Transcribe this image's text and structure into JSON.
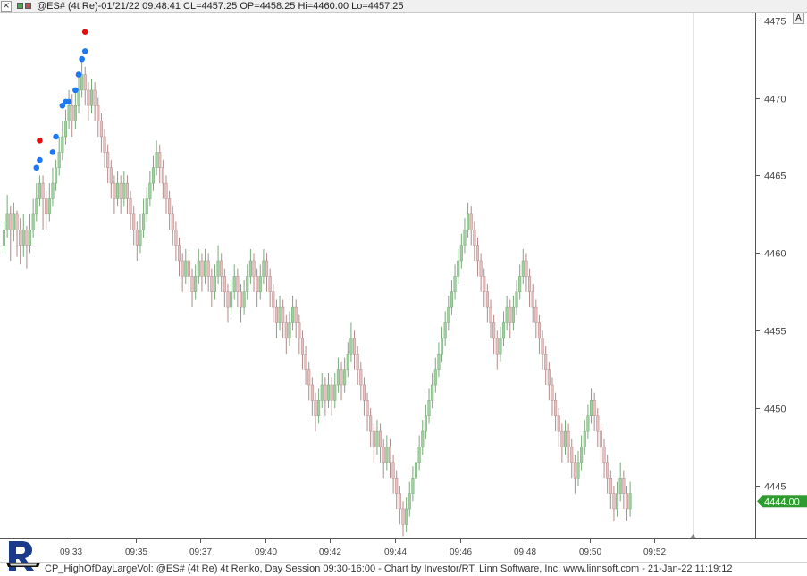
{
  "window": {
    "close_glyph": "×",
    "legend": "@ES# (4t Re)-01/21/22 09:48:41 CL=4457.25 OP=4458.25 Hi=4460.00 Lo=4457.25",
    "autoscale_label": "A"
  },
  "footer": {
    "caption": "CP_HighOfDayLargeVol: @ES# (4t Re) 4t Renko, Day Session 09:30-16:00 - Chart by Investor/RT, Linn Software, Inc. www.linnsoft.com - 21-Jan-22 11:19:12"
  },
  "colors": {
    "up_bar": "#9fd19f",
    "up_bar_edge": "#7aa97a",
    "down_bar": "#e8c0c0",
    "down_bar_edge": "#b08a8a",
    "blue_marker": "#1e78f0",
    "red_marker": "#e01010",
    "last_price_bg": "#2f9a2f"
  },
  "chart_data": {
    "type": "renko",
    "instrument": "@ES#",
    "brick_size_ticks": 4,
    "brick_size_points": 1.0,
    "y_ticks": [
      4445,
      4450,
      4455,
      4460,
      4465,
      4470,
      4475
    ],
    "ylim": [
      4441.6,
      4475.5
    ],
    "x_ticks": [
      "09:33",
      "09:35",
      "09:37",
      "09:40",
      "09:42",
      "09:44",
      "09:46",
      "09:48",
      "09:50",
      "09:52"
    ],
    "x_tick_bar_index": [
      20.5,
      40.5,
      60.5,
      80.5,
      100.5,
      120.5,
      140.5,
      160.5,
      180.5,
      200.5
    ],
    "last_price": "4444.00",
    "bars": [
      [
        4460.5,
        4461.5,
        4460.0,
        4462.0
      ],
      [
        4461.5,
        4462.5,
        4461.0,
        4463.75
      ],
      [
        4462.5,
        4461.5,
        4459.5,
        4463.0
      ],
      [
        4461.5,
        4462.5,
        4460.75,
        4463.25
      ],
      [
        4462.5,
        4461.5,
        4459.75,
        4462.75
      ],
      [
        4461.5,
        4460.5,
        4459.25,
        4462.25
      ],
      [
        4460.5,
        4461.5,
        4459.75,
        4462.5
      ],
      [
        4461.5,
        4460.5,
        4459.0,
        4461.75
      ],
      [
        4460.5,
        4461.5,
        4460.0,
        4462.5
      ],
      [
        4461.5,
        4462.5,
        4461.0,
        4463.5
      ],
      [
        4462.5,
        4463.5,
        4462.0,
        4464.5
      ],
      [
        4463.5,
        4464.5,
        4463.0,
        4465.0
      ],
      [
        4464.5,
        4463.5,
        4461.5,
        4465.0
      ],
      [
        4463.5,
        4462.5,
        4461.5,
        4464.0
      ],
      [
        4462.5,
        4463.5,
        4462.0,
        4464.5
      ],
      [
        4463.5,
        4464.5,
        4463.0,
        4465.5
      ],
      [
        4464.5,
        4465.5,
        4464.0,
        4466.0
      ],
      [
        4465.5,
        4466.5,
        4465.0,
        4467.5
      ],
      [
        4466.5,
        4467.5,
        4466.0,
        4468.5
      ],
      [
        4467.5,
        4468.5,
        4467.0,
        4469.25
      ],
      [
        4468.5,
        4469.5,
        4468.0,
        4470.5
      ],
      [
        4469.5,
        4468.5,
        4467.5,
        4470.25
      ],
      [
        4468.5,
        4469.5,
        4468.0,
        4470.5
      ],
      [
        4469.5,
        4470.5,
        4469.0,
        4471.5
      ],
      [
        4470.5,
        4471.5,
        4470.0,
        4472.5
      ],
      [
        4471.5,
        4470.5,
        4469.5,
        4472.0
      ],
      [
        4470.5,
        4469.5,
        4468.5,
        4471.0
      ],
      [
        4469.5,
        4470.5,
        4469.0,
        4471.25
      ],
      [
        4470.5,
        4469.5,
        4468.5,
        4471.0
      ],
      [
        4469.5,
        4468.5,
        4467.5,
        4470.0
      ],
      [
        4468.5,
        4467.5,
        4466.5,
        4469.0
      ],
      [
        4467.5,
        4466.5,
        4465.5,
        4468.0
      ],
      [
        4466.5,
        4465.5,
        4464.5,
        4467.0
      ],
      [
        4465.5,
        4464.5,
        4463.5,
        4466.0
      ],
      [
        4464.5,
        4463.5,
        4462.5,
        4465.0
      ],
      [
        4463.5,
        4464.5,
        4463.0,
        4465.25
      ],
      [
        4464.5,
        4463.5,
        4462.5,
        4465.0
      ],
      [
        4463.5,
        4464.5,
        4463.0,
        4465.25
      ],
      [
        4464.5,
        4463.5,
        4462.5,
        4465.0
      ],
      [
        4463.5,
        4462.5,
        4461.5,
        4464.0
      ],
      [
        4462.5,
        4461.5,
        4460.5,
        4463.0
      ],
      [
        4461.5,
        4460.5,
        4459.5,
        4462.0
      ],
      [
        4460.5,
        4461.5,
        4460.0,
        4462.5
      ],
      [
        4461.5,
        4462.5,
        4461.0,
        4463.5
      ],
      [
        4462.5,
        4463.5,
        4462.0,
        4464.25
      ],
      [
        4463.5,
        4464.5,
        4463.0,
        4465.25
      ],
      [
        4464.5,
        4465.5,
        4464.0,
        4466.25
      ],
      [
        4465.5,
        4466.5,
        4465.0,
        4467.25
      ],
      [
        4466.5,
        4465.5,
        4464.5,
        4467.0
      ],
      [
        4465.5,
        4464.5,
        4463.5,
        4466.0
      ],
      [
        4464.5,
        4463.5,
        4462.5,
        4465.0
      ],
      [
        4463.5,
        4462.5,
        4461.5,
        4464.0
      ],
      [
        4462.5,
        4461.5,
        4460.5,
        4463.0
      ],
      [
        4461.5,
        4460.5,
        4459.5,
        4462.0
      ],
      [
        4460.5,
        4459.5,
        4458.5,
        4461.0
      ],
      [
        4459.5,
        4458.5,
        4457.5,
        4460.0
      ],
      [
        4458.5,
        4459.5,
        4458.0,
        4460.25
      ],
      [
        4459.5,
        4458.5,
        4457.5,
        4460.0
      ],
      [
        4458.5,
        4457.5,
        4456.5,
        4459.0
      ],
      [
        4457.5,
        4458.5,
        4457.0,
        4459.25
      ],
      [
        4458.5,
        4459.5,
        4458.0,
        4460.25
      ],
      [
        4459.5,
        4458.5,
        4457.5,
        4460.0
      ],
      [
        4458.5,
        4459.5,
        4458.0,
        4460.25
      ],
      [
        4459.5,
        4458.5,
        4457.5,
        4460.0
      ],
      [
        4458.5,
        4457.5,
        4456.5,
        4459.0
      ],
      [
        4457.5,
        4458.5,
        4457.0,
        4459.25
      ],
      [
        4458.5,
        4459.5,
        4458.0,
        4460.5
      ],
      [
        4459.5,
        4458.5,
        4457.5,
        4460.0
      ],
      [
        4458.5,
        4457.5,
        4456.5,
        4459.0
      ],
      [
        4457.5,
        4456.5,
        4455.5,
        4458.0
      ],
      [
        4456.5,
        4457.5,
        4456.0,
        4458.25
      ],
      [
        4457.5,
        4458.5,
        4457.0,
        4459.25
      ],
      [
        4458.5,
        4457.5,
        4456.5,
        4459.0
      ],
      [
        4457.5,
        4456.5,
        4455.5,
        4458.0
      ],
      [
        4456.5,
        4457.5,
        4456.0,
        4458.25
      ],
      [
        4457.5,
        4458.5,
        4457.0,
        4459.25
      ],
      [
        4458.5,
        4459.5,
        4458.0,
        4460.25
      ],
      [
        4459.5,
        4458.5,
        4457.5,
        4460.0
      ],
      [
        4458.5,
        4457.5,
        4456.5,
        4459.0
      ],
      [
        4457.5,
        4458.5,
        4457.0,
        4459.25
      ],
      [
        4458.5,
        4459.5,
        4458.0,
        4460.25
      ],
      [
        4459.5,
        4458.5,
        4457.5,
        4460.0
      ],
      [
        4458.5,
        4457.5,
        4456.5,
        4459.0
      ],
      [
        4457.5,
        4456.5,
        4455.5,
        4458.0
      ],
      [
        4456.5,
        4455.5,
        4454.5,
        4457.0
      ],
      [
        4455.5,
        4456.5,
        4455.0,
        4457.25
      ],
      [
        4456.5,
        4455.5,
        4454.5,
        4457.0
      ],
      [
        4455.5,
        4454.5,
        4453.5,
        4456.0
      ],
      [
        4454.5,
        4455.5,
        4454.0,
        4456.25
      ],
      [
        4455.5,
        4456.5,
        4455.0,
        4457.25
      ],
      [
        4456.5,
        4455.5,
        4454.5,
        4457.0
      ],
      [
        4455.5,
        4454.5,
        4453.5,
        4456.0
      ],
      [
        4454.5,
        4453.5,
        4452.5,
        4455.0
      ],
      [
        4453.5,
        4452.5,
        4451.5,
        4454.0
      ],
      [
        4452.5,
        4451.5,
        4450.5,
        4453.0
      ],
      [
        4451.5,
        4450.5,
        4449.5,
        4452.0
      ],
      [
        4450.5,
        4449.5,
        4448.5,
        4451.0
      ],
      [
        4449.5,
        4450.5,
        4449.0,
        4451.25
      ],
      [
        4450.5,
        4451.5,
        4450.0,
        4452.25
      ],
      [
        4451.5,
        4450.5,
        4449.5,
        4452.0
      ],
      [
        4450.5,
        4451.5,
        4450.0,
        4452.25
      ],
      [
        4451.5,
        4450.5,
        4449.5,
        4452.0
      ],
      [
        4450.5,
        4451.5,
        4450.0,
        4452.25
      ],
      [
        4451.5,
        4452.5,
        4451.0,
        4453.25
      ],
      [
        4452.5,
        4451.5,
        4450.5,
        4453.0
      ],
      [
        4451.5,
        4452.5,
        4451.0,
        4453.25
      ],
      [
        4452.5,
        4453.5,
        4452.0,
        4454.25
      ],
      [
        4453.5,
        4454.5,
        4453.0,
        4455.5
      ],
      [
        4454.5,
        4453.5,
        4452.5,
        4455.0
      ],
      [
        4453.5,
        4452.5,
        4451.5,
        4454.0
      ],
      [
        4452.5,
        4451.5,
        4450.5,
        4453.0
      ],
      [
        4451.5,
        4450.5,
        4449.5,
        4452.0
      ],
      [
        4450.5,
        4449.5,
        4448.5,
        4451.0
      ],
      [
        4449.5,
        4448.5,
        4447.5,
        4450.0
      ],
      [
        4448.5,
        4447.5,
        4446.5,
        4449.0
      ],
      [
        4447.5,
        4448.5,
        4447.0,
        4449.25
      ],
      [
        4448.5,
        4447.5,
        4446.5,
        4449.0
      ],
      [
        4447.5,
        4446.5,
        4445.5,
        4448.0
      ],
      [
        4446.5,
        4447.5,
        4446.0,
        4448.25
      ],
      [
        4447.5,
        4446.5,
        4445.5,
        4448.0
      ],
      [
        4446.5,
        4445.5,
        4444.5,
        4447.0
      ],
      [
        4445.5,
        4444.5,
        4443.5,
        4446.0
      ],
      [
        4444.5,
        4443.5,
        4442.5,
        4445.0
      ],
      [
        4443.5,
        4442.5,
        4441.75,
        4444.0
      ],
      [
        4442.5,
        4443.5,
        4442.0,
        4444.25
      ],
      [
        4443.5,
        4444.5,
        4443.0,
        4445.25
      ],
      [
        4444.5,
        4445.5,
        4444.0,
        4446.25
      ],
      [
        4445.5,
        4446.5,
        4445.0,
        4447.25
      ],
      [
        4446.5,
        4447.5,
        4446.0,
        4448.25
      ],
      [
        4447.5,
        4448.5,
        4447.0,
        4449.25
      ],
      [
        4448.5,
        4449.5,
        4448.0,
        4450.25
      ],
      [
        4449.5,
        4450.5,
        4449.0,
        4451.25
      ],
      [
        4450.5,
        4451.5,
        4450.0,
        4452.25
      ],
      [
        4451.5,
        4452.5,
        4451.0,
        4453.25
      ],
      [
        4452.5,
        4453.5,
        4452.0,
        4454.25
      ],
      [
        4453.5,
        4454.5,
        4453.0,
        4455.25
      ],
      [
        4454.5,
        4455.5,
        4454.0,
        4456.25
      ],
      [
        4455.5,
        4456.5,
        4455.0,
        4457.25
      ],
      [
        4456.5,
        4457.5,
        4456.0,
        4458.25
      ],
      [
        4457.5,
        4458.5,
        4457.0,
        4459.25
      ],
      [
        4458.5,
        4459.5,
        4458.0,
        4460.25
      ],
      [
        4459.5,
        4460.5,
        4459.0,
        4461.25
      ],
      [
        4460.5,
        4461.5,
        4460.0,
        4462.25
      ],
      [
        4461.5,
        4462.5,
        4461.0,
        4463.25
      ],
      [
        4462.5,
        4461.5,
        4460.5,
        4463.0
      ],
      [
        4461.5,
        4460.5,
        4459.5,
        4462.0
      ],
      [
        4460.5,
        4459.5,
        4458.5,
        4461.0
      ],
      [
        4459.5,
        4458.5,
        4457.5,
        4460.0
      ],
      [
        4458.5,
        4457.5,
        4456.5,
        4459.0
      ],
      [
        4457.5,
        4456.5,
        4455.5,
        4458.0
      ],
      [
        4456.5,
        4455.5,
        4454.5,
        4457.0
      ],
      [
        4455.5,
        4454.5,
        4453.5,
        4456.0
      ],
      [
        4454.5,
        4453.5,
        4452.5,
        4455.0
      ],
      [
        4453.5,
        4454.5,
        4453.0,
        4455.25
      ],
      [
        4454.5,
        4455.5,
        4454.0,
        4456.25
      ],
      [
        4455.5,
        4456.5,
        4455.0,
        4457.25
      ],
      [
        4456.5,
        4455.5,
        4454.5,
        4457.0
      ],
      [
        4455.5,
        4456.5,
        4455.0,
        4457.25
      ],
      [
        4456.5,
        4457.5,
        4456.0,
        4458.25
      ],
      [
        4457.5,
        4458.5,
        4457.0,
        4459.25
      ],
      [
        4458.5,
        4459.5,
        4458.0,
        4460.25
      ],
      [
        4459.5,
        4458.5,
        4457.5,
        4460.0
      ],
      [
        4458.5,
        4457.5,
        4456.5,
        4459.0
      ],
      [
        4457.5,
        4456.5,
        4455.5,
        4458.0
      ],
      [
        4456.5,
        4455.5,
        4454.5,
        4457.0
      ],
      [
        4455.5,
        4454.5,
        4453.5,
        4456.0
      ],
      [
        4454.5,
        4453.5,
        4452.5,
        4455.0
      ],
      [
        4453.5,
        4452.5,
        4451.5,
        4454.0
      ],
      [
        4452.5,
        4451.5,
        4450.5,
        4453.0
      ],
      [
        4451.5,
        4450.5,
        4449.5,
        4452.0
      ],
      [
        4450.5,
        4449.5,
        4448.5,
        4451.0
      ],
      [
        4449.5,
        4448.5,
        4447.5,
        4450.0
      ],
      [
        4448.5,
        4447.5,
        4446.5,
        4449.0
      ],
      [
        4447.5,
        4448.5,
        4447.0,
        4449.25
      ],
      [
        4448.5,
        4447.5,
        4446.5,
        4449.0
      ],
      [
        4447.5,
        4446.5,
        4445.5,
        4448.0
      ],
      [
        4446.5,
        4445.5,
        4444.5,
        4447.0
      ],
      [
        4445.5,
        4446.5,
        4445.0,
        4447.25
      ],
      [
        4446.5,
        4447.5,
        4446.0,
        4448.25
      ],
      [
        4447.5,
        4448.5,
        4447.0,
        4449.25
      ],
      [
        4448.5,
        4449.5,
        4448.0,
        4450.25
      ],
      [
        4449.5,
        4450.5,
        4449.0,
        4451.25
      ],
      [
        4450.5,
        4449.5,
        4448.5,
        4451.0
      ],
      [
        4449.5,
        4448.5,
        4447.5,
        4450.0
      ],
      [
        4448.5,
        4447.5,
        4446.5,
        4449.0
      ],
      [
        4447.5,
        4446.5,
        4445.5,
        4448.0
      ],
      [
        4446.5,
        4445.5,
        4444.5,
        4447.0
      ],
      [
        4445.5,
        4444.5,
        4443.5,
        4446.0
      ],
      [
        4444.5,
        4443.5,
        4442.75,
        4445.0
      ],
      [
        4443.5,
        4444.5,
        4443.0,
        4445.25
      ],
      [
        4444.5,
        4445.5,
        4444.0,
        4446.5
      ],
      [
        4445.5,
        4444.5,
        4443.5,
        4446.0
      ],
      [
        4444.5,
        4443.5,
        4442.75,
        4445.0
      ],
      [
        4443.5,
        4444.5,
        4443.0,
        4445.25
      ]
    ],
    "blue_markers": [
      [
        10,
        4465.5
      ],
      [
        11,
        4466.0
      ],
      [
        15,
        4466.5
      ],
      [
        16,
        4467.5
      ],
      [
        18,
        4469.5
      ],
      [
        19,
        4469.75
      ],
      [
        20,
        4469.75
      ],
      [
        22,
        4470.5
      ],
      [
        23,
        4471.5
      ],
      [
        24,
        4472.5
      ],
      [
        25,
        4473.0
      ]
    ],
    "red_markers": [
      [
        11,
        4467.25
      ],
      [
        25,
        4474.25
      ]
    ]
  }
}
